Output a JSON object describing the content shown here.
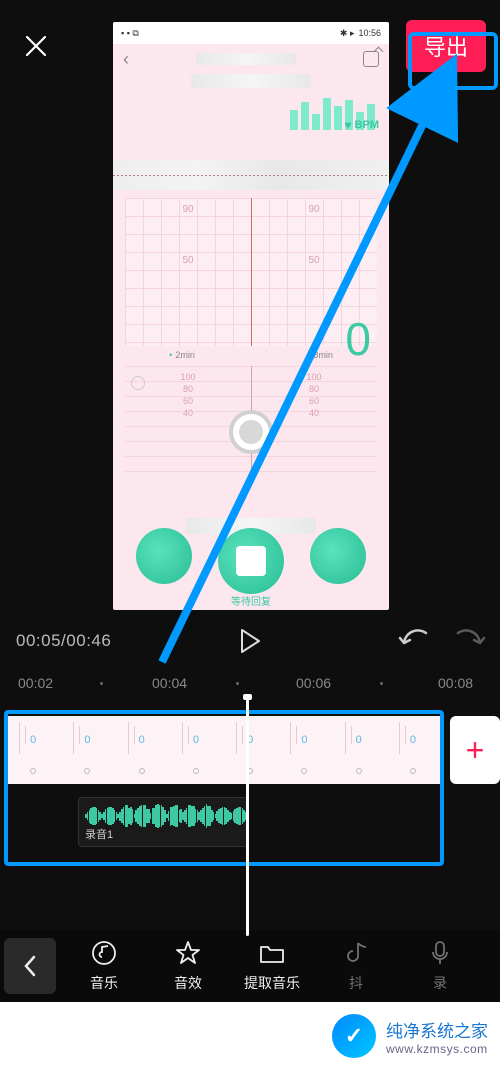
{
  "topbar": {
    "export_label": "导出"
  },
  "preview": {
    "status_time": "10:56",
    "bpm_label": "BPM",
    "grid_upper": [
      "90",
      "90",
      "50",
      "50"
    ],
    "time_marks": [
      "2min",
      "3min"
    ],
    "grid_lower": [
      "100",
      "100",
      "80",
      "80",
      "60",
      "60",
      "40",
      "40"
    ],
    "big_value": "0",
    "caption": "等待回复"
  },
  "playback": {
    "current": "00:05",
    "total": "00:46"
  },
  "ruler": [
    "00:02",
    "00:04",
    "00:06",
    "00:08"
  ],
  "audio": {
    "clip_label": "录音1"
  },
  "toolbar": {
    "items": [
      {
        "label": "音乐"
      },
      {
        "label": "音效"
      },
      {
        "label": "提取音乐"
      },
      {
        "label": "抖"
      },
      {
        "label": "录"
      }
    ]
  },
  "watermark": {
    "title": "纯净系统之家",
    "url": "www.kzmsys.com"
  },
  "clip_numbers": [
    "0",
    "0",
    "0",
    "0",
    "0",
    "0",
    "0",
    "0"
  ]
}
